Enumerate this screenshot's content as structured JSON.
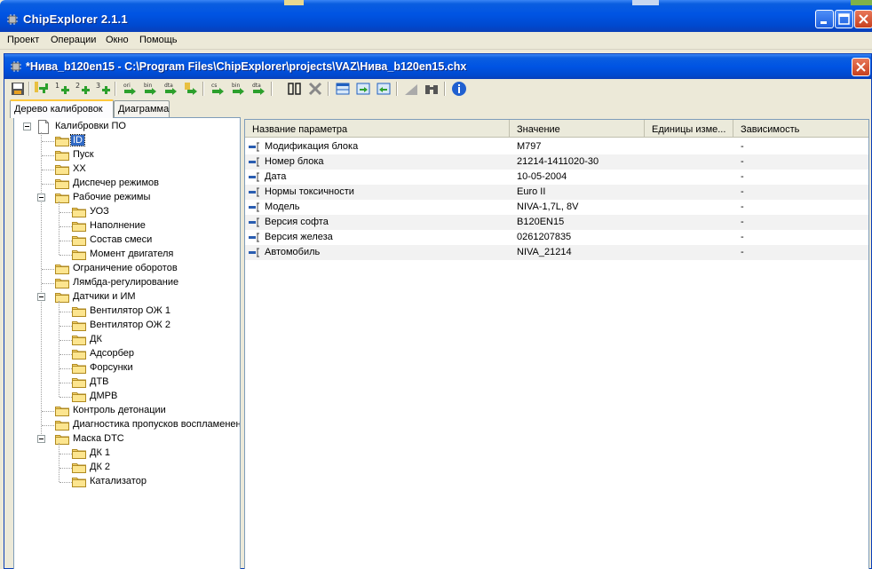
{
  "app": {
    "title": "ChipExplorer 2.1.1"
  },
  "menu": {
    "items": [
      "Проект",
      "Операции",
      "Окно",
      "Помощь"
    ]
  },
  "document": {
    "title": "*Нива_b120en15 - C:\\Program Files\\ChipExplorer\\projects\\VAZ\\Нива_b120en15.chx"
  },
  "toolbar": {
    "buttons": [
      "save-icon",
      "add-icon",
      "add-1-icon",
      "add-2-icon",
      "add-3-icon",
      "ori-icon",
      "bin-icon",
      "dta-icon",
      "export-icon",
      "cs-icon",
      "bin-2-icon",
      "dta-2-icon",
      "compare-icon",
      "delete-icon",
      "table-icon",
      "table-export-icon",
      "table-import-icon",
      "graph-icon",
      "binoculars-icon",
      "info-icon"
    ]
  },
  "tabs": [
    {
      "label": "Дерево калибровок",
      "active": true
    },
    {
      "label": "Диаграмма",
      "active": false
    }
  ],
  "tree": {
    "root": "Калибровки ПО",
    "items": [
      {
        "label": "ID",
        "level": 1,
        "selected": true
      },
      {
        "label": "Пуск",
        "level": 1
      },
      {
        "label": "XX",
        "level": 1
      },
      {
        "label": "Диспечер режимов",
        "level": 1
      },
      {
        "label": "Рабочие режимы",
        "level": 1,
        "expanded": true
      },
      {
        "label": "УОЗ",
        "level": 2
      },
      {
        "label": "Наполнение",
        "level": 2
      },
      {
        "label": "Состав смеси",
        "level": 2
      },
      {
        "label": "Момент двигателя",
        "level": 2
      },
      {
        "label": "Ограничение оборотов",
        "level": 1
      },
      {
        "label": "Лямбда-регулирование",
        "level": 1
      },
      {
        "label": "Датчики и ИМ",
        "level": 1,
        "expanded": true
      },
      {
        "label": "Вентилятор ОЖ 1",
        "level": 2
      },
      {
        "label": "Вентилятор ОЖ 2",
        "level": 2
      },
      {
        "label": "ДК",
        "level": 2
      },
      {
        "label": "Адсорбер",
        "level": 2
      },
      {
        "label": "Форсунки",
        "level": 2
      },
      {
        "label": "ДТВ",
        "level": 2
      },
      {
        "label": "ДМРВ",
        "level": 2
      },
      {
        "label": "Контроль детонации",
        "level": 1
      },
      {
        "label": "Диагностика пропусков воспламенен",
        "level": 1
      },
      {
        "label": "Маска DTC",
        "level": 1,
        "expanded": true
      },
      {
        "label": "ДК 1",
        "level": 2
      },
      {
        "label": "ДК 2",
        "level": 2
      },
      {
        "label": "Катализатор",
        "level": 2
      }
    ]
  },
  "grid": {
    "columns": [
      "Название параметра",
      "Значение",
      "Единицы изме...",
      "Зависимость"
    ],
    "rows": [
      {
        "name": "Модификация блока",
        "value": "M797",
        "units": "",
        "dep": "-"
      },
      {
        "name": "Номер блока",
        "value": "21214-1411020-30",
        "units": "",
        "dep": "-"
      },
      {
        "name": "Дата",
        "value": "10-05-2004",
        "units": "",
        "dep": "-"
      },
      {
        "name": "Нормы токсичности",
        "value": "Euro II",
        "units": "",
        "dep": "-"
      },
      {
        "name": "Модель",
        "value": "NIVA-1,7L, 8V",
        "units": "",
        "dep": "-"
      },
      {
        "name": "Версия софта",
        "value": "B120EN15",
        "units": "",
        "dep": "-"
      },
      {
        "name": "Версия железа",
        "value": "0261207835",
        "units": "",
        "dep": "-"
      },
      {
        "name": "Автомобиль",
        "value": "NIVA_21214",
        "units": "",
        "dep": "-"
      }
    ]
  },
  "colors": {
    "titlebar": "#0054e3",
    "selection": "#316ac5",
    "folder": "#f8d775"
  }
}
